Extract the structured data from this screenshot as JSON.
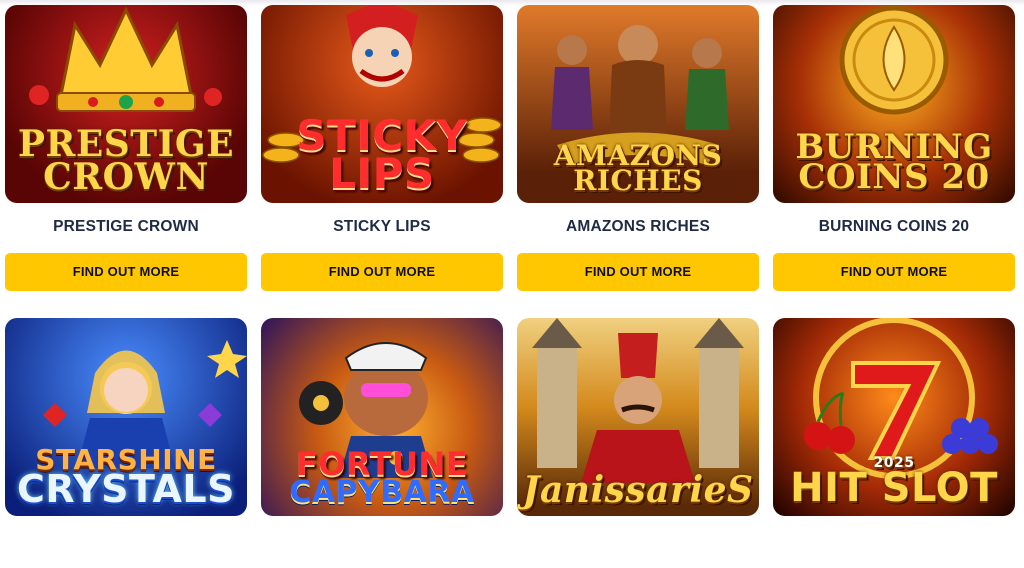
{
  "games": [
    {
      "title": "PRESTIGE CROWN",
      "button": "FIND OUT MORE",
      "logo": [
        "PRESTIGE",
        "CROWN"
      ],
      "bg": [
        "#b31212",
        "#5a0505"
      ],
      "accent": "#ffd54a"
    },
    {
      "title": "STICKY LIPS",
      "button": "FIND OUT MORE",
      "logo": [
        "STICKY",
        "LIPS"
      ],
      "bg": [
        "#d4380d",
        "#6b1300"
      ],
      "accent": "#ffcc33"
    },
    {
      "title": "AMAZONS RICHES",
      "button": "FIND OUT MORE",
      "logo": [
        "AMAZONS",
        "RICHES"
      ],
      "bg": [
        "#c7541a",
        "#4a1a08"
      ],
      "accent": "#ffd54a"
    },
    {
      "title": "BURNING COINS 20",
      "button": "FIND OUT MORE",
      "logo": [
        "BURNING",
        "COINS 20"
      ],
      "bg": [
        "#e0671a",
        "#4a1500"
      ],
      "accent": "#ffd54a"
    },
    {
      "title": "",
      "button": "",
      "logo": [
        "STARSHINE",
        "CRYSTALS"
      ],
      "bg": [
        "#2a6cf0",
        "#0b1f7a"
      ],
      "accent": "#ffd54a"
    },
    {
      "title": "",
      "button": "",
      "logo": [
        "FORTUNE",
        "CAPYBARA"
      ],
      "bg": [
        "#e86f12",
        "#3a1a55"
      ],
      "accent": "#ff3b3b"
    },
    {
      "title": "",
      "button": "",
      "logo": [
        "JanissarieS"
      ],
      "bg": [
        "#d48a1c",
        "#5a2a08"
      ],
      "accent": "#ffd54a"
    },
    {
      "title": "",
      "button": "",
      "logo": [
        "2025",
        "HIT SLOT"
      ],
      "bg": [
        "#c0390b",
        "#2a0600"
      ],
      "accent": "#ffd54a"
    }
  ]
}
